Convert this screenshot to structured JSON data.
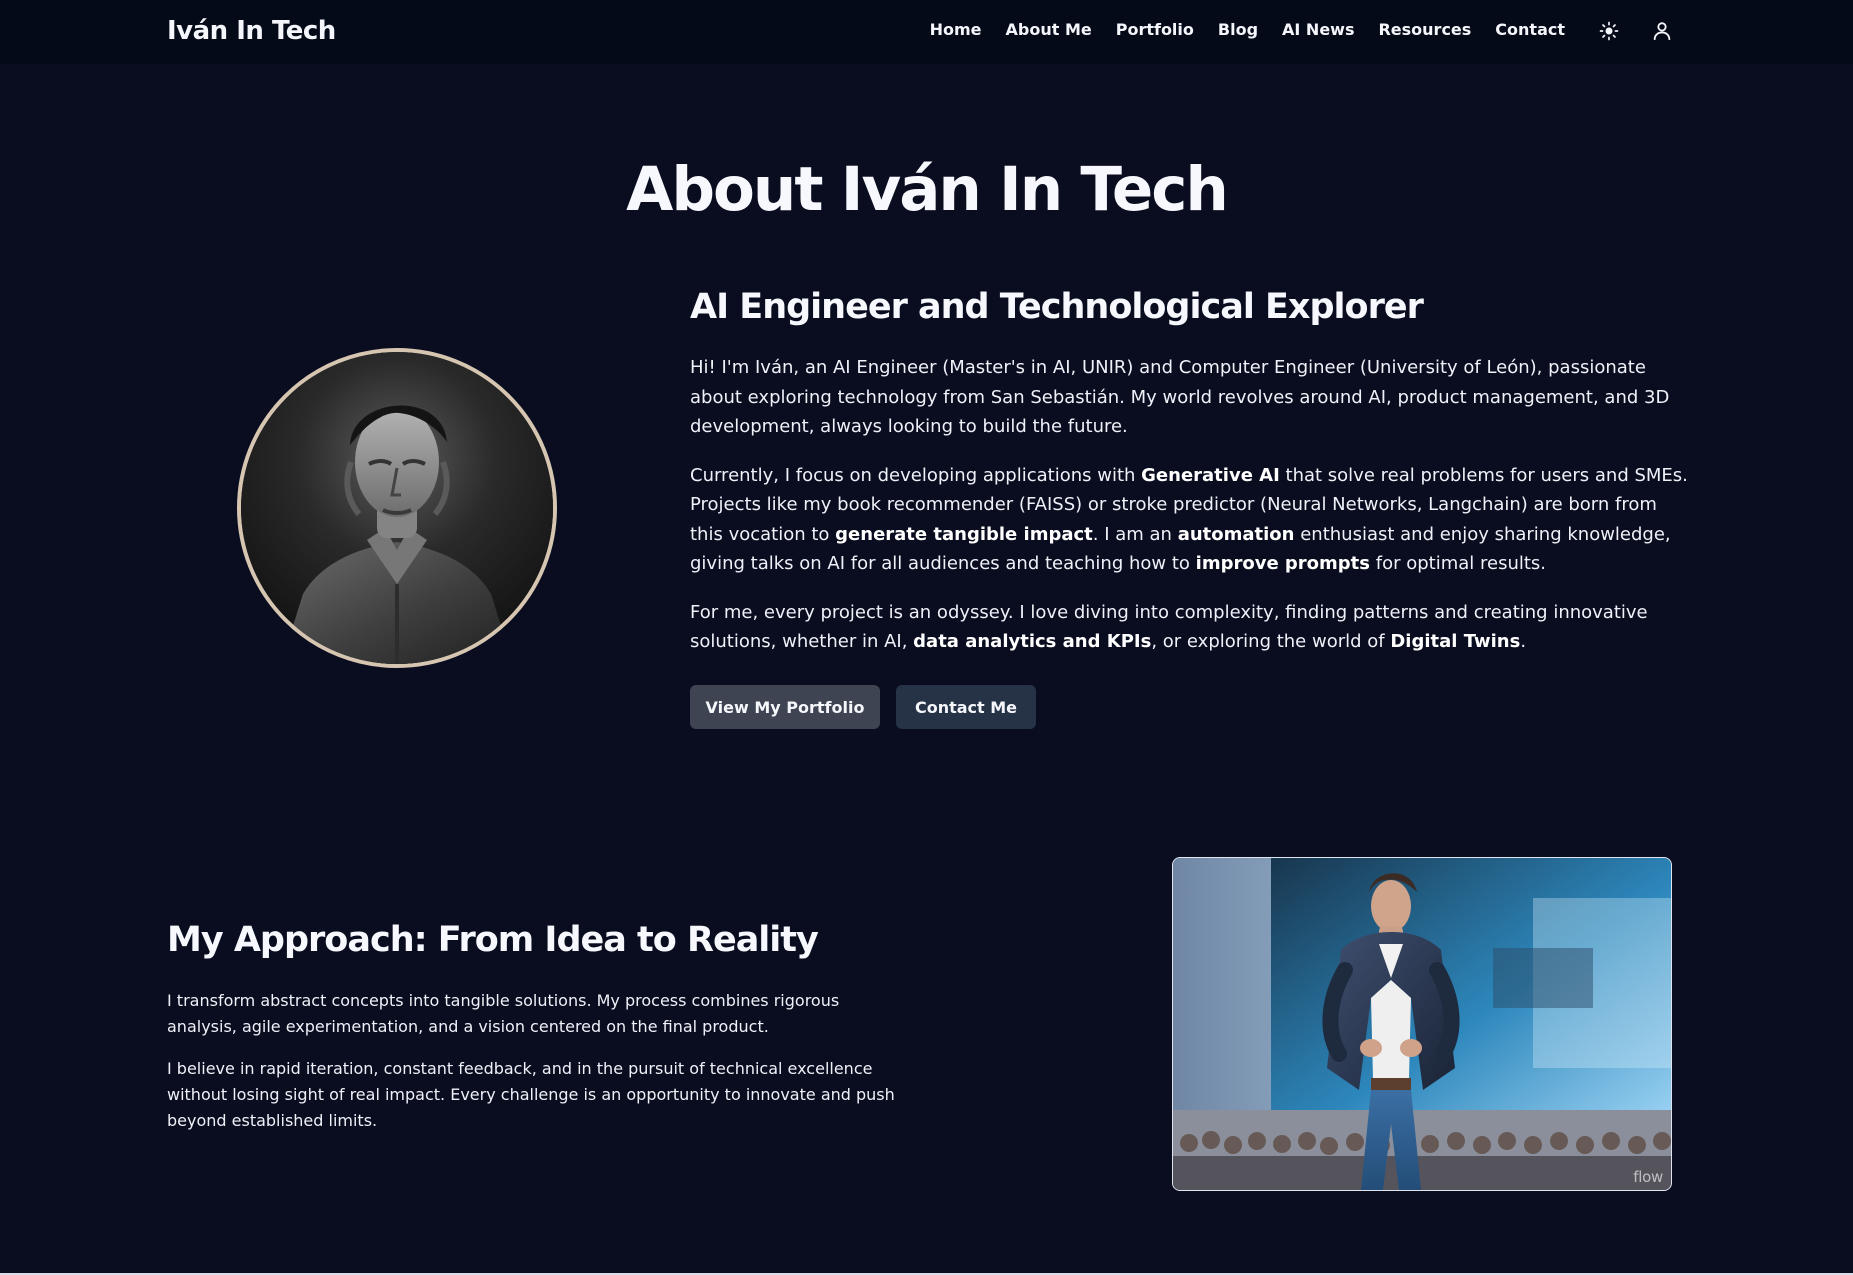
{
  "header": {
    "brand": "Iván In Tech",
    "nav": {
      "home": "Home",
      "about": "About Me",
      "portfolio": "Portfolio",
      "blog": "Blog",
      "ai_news": "AI News",
      "resources": "Resources",
      "contact": "Contact"
    },
    "icons": {
      "theme": "sun-icon",
      "user": "user-icon"
    }
  },
  "page": {
    "title": "About Iván In Tech"
  },
  "about": {
    "heading": "AI Engineer and Technological Explorer",
    "p1": "Hi! I'm Iván, an AI Engineer (Master's in AI, UNIR) and Computer Engineer (University of León), passionate about exploring technology from San Sebastián. My world revolves around AI, product management, and 3D development, always looking to build the future.",
    "p2": {
      "t1": "Currently, I focus on developing applications with ",
      "b1": "Generative AI",
      "t2": " that solve real problems for users and SMEs. Projects like my book recommender (FAISS) or stroke predictor (Neural Networks, Langchain) are born from this vocation to ",
      "b2": "generate tangible impact",
      "t3": ". I am an ",
      "b3": "automation",
      "t4": " enthusiast and enjoy sharing knowledge, giving talks on AI for all audiences and teaching how to ",
      "b4": "improve prompts",
      "t5": " for optimal results."
    },
    "p3": {
      "t1": "For me, every project is an odyssey. I love diving into complexity, finding patterns and creating innovative solutions, whether in AI, ",
      "b1": "data analytics and KPIs",
      "t2": ", or exploring the world of ",
      "b2": "Digital Twins",
      "t3": "."
    },
    "buttons": {
      "portfolio": "View My Portfolio",
      "contact": "Contact Me"
    }
  },
  "approach": {
    "heading": "My Approach: From Idea to Reality",
    "p1": "I transform abstract concepts into tangible solutions. My process combines rigorous analysis, agile experimentation, and a vision centered on the final product.",
    "p2": "I believe in rapid iteration, constant feedback, and in the pursuit of technical excellence without losing sight of real impact. Every challenge is an opportunity to innovate and push beyond established limits."
  },
  "media": {
    "watermark": "flow"
  },
  "colors": {
    "background": "#090d1f",
    "nav_background": "#050a18",
    "portfolio_button": "#3e4451",
    "contact_button": "#263347",
    "portrait_ring": "#d6c6b1"
  }
}
